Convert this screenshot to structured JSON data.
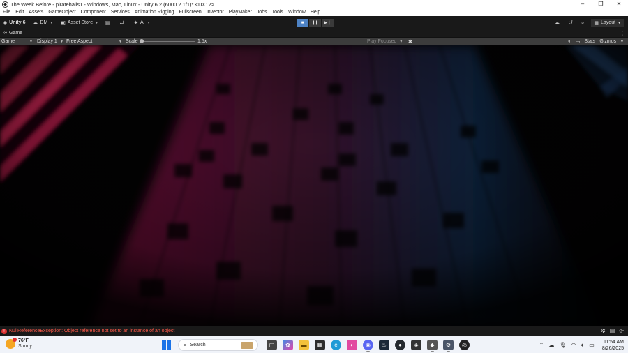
{
  "window": {
    "title": "The Week Before - piratehalls1 - Windows, Mac, Linux - Unity 6.2 (6000.2.1f1)* <DX12>",
    "controls": [
      "–",
      "❐",
      "✕"
    ]
  },
  "menu": [
    "File",
    "Edit",
    "Assets",
    "GameObject",
    "Component",
    "Services",
    "Animation Rigging",
    "Fullscreen",
    "Invector",
    "PlayMaker",
    "Jobs",
    "Tools",
    "Window",
    "Help"
  ],
  "toolbar": {
    "unity_label": "Unity 6",
    "account_label": "DM",
    "asset_store_label": "Asset Store",
    "ai_label": "AI",
    "layout_label": "Layout"
  },
  "tab": {
    "label": "Game"
  },
  "gamebar": {
    "mode": "Game",
    "display": "Display 1",
    "aspect": "Free Aspect",
    "scale_label": "Scale",
    "scale_value": "1.5x",
    "play_focused": "Play Focused",
    "stats_label": "Stats",
    "gizmos_label": "Gizmos"
  },
  "console": {
    "error_message": "NullReferenceException: Object reference not set to an instance of an object"
  },
  "taskbar": {
    "weather_temp": "76°F",
    "weather_condition": "Sunny",
    "search_placeholder": "Search",
    "time": "11:54 AM",
    "date": "8/26/2025"
  },
  "colors": {
    "editor_dark": "#191919",
    "play_active": "#4d82c4",
    "error_red": "#ff5a4a",
    "scene_pink": "#c2185b",
    "scene_blue": "#1e4f8c"
  }
}
